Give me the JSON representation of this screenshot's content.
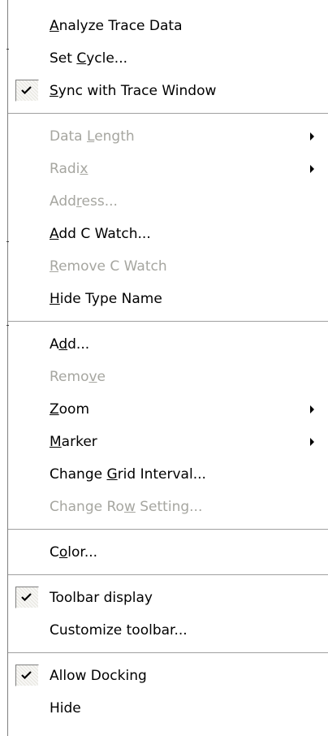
{
  "menu": {
    "analyze_trace_data": {
      "pre": "",
      "key": "A",
      "post": "nalyze Trace Data"
    },
    "set_cycle": {
      "pre": "Set ",
      "key": "C",
      "post": "ycle..."
    },
    "sync_with_trace_window": {
      "pre": "",
      "key": "S",
      "post": "ync with Trace Window",
      "checked": true
    },
    "data_length": {
      "pre": "Data ",
      "key": "L",
      "post": "ength"
    },
    "radix": {
      "pre": "Radi",
      "key": "x",
      "post": ""
    },
    "address": {
      "pre": "Add",
      "key": "r",
      "post": "ess..."
    },
    "add_c_watch": {
      "pre": "",
      "key": "A",
      "post": "dd C Watch..."
    },
    "remove_c_watch": {
      "pre": "",
      "key": "R",
      "post": "emove C Watch"
    },
    "hide_type_name": {
      "pre": "",
      "key": "H",
      "post": "ide Type Name"
    },
    "add": {
      "pre": "A",
      "key": "d",
      "post": "d..."
    },
    "remove": {
      "pre": "Remo",
      "key": "v",
      "post": "e"
    },
    "zoom": {
      "pre": "",
      "key": "Z",
      "post": "oom"
    },
    "marker": {
      "pre": "",
      "key": "M",
      "post": "arker"
    },
    "change_grid_interval": {
      "pre": "Change ",
      "key": "G",
      "post": "rid Interval..."
    },
    "change_row_setting": {
      "pre": "Change Ro",
      "key": "w",
      "post": " Setting..."
    },
    "color": {
      "pre": "C",
      "key": "o",
      "post": "lor..."
    },
    "toolbar_display": {
      "pre": "",
      "key": "",
      "post": "Toolbar display",
      "checked": true
    },
    "customize_toolbar": {
      "pre": "",
      "key": "",
      "post": "Customize toolbar..."
    },
    "allow_docking": {
      "pre": "",
      "key": "",
      "post": "Allow Docking",
      "checked": true
    },
    "hide": {
      "pre": "",
      "key": "",
      "post": "Hide"
    }
  }
}
